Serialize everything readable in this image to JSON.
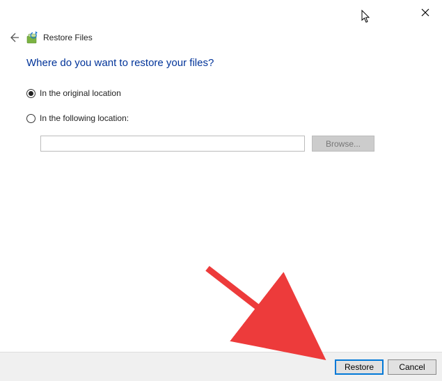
{
  "window": {
    "title": "Restore Files"
  },
  "heading": "Where do you want to restore your files?",
  "options": {
    "original": {
      "label": "In the original location",
      "selected": true
    },
    "custom": {
      "label": "In the following location:",
      "selected": false
    }
  },
  "path": {
    "value": "",
    "placeholder": ""
  },
  "buttons": {
    "browse": "Browse...",
    "restore": "Restore",
    "cancel": "Cancel"
  }
}
